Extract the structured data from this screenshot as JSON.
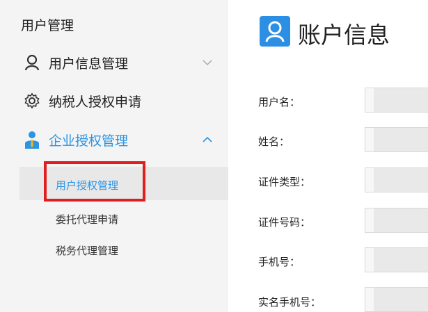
{
  "sidebar": {
    "title": "用户管理",
    "menu": [
      {
        "label": "用户信息管理",
        "icon": "user-outline-icon",
        "expanded": false
      },
      {
        "label": "纳税人授权申请",
        "icon": "gear-icon"
      },
      {
        "label": "企业授权管理",
        "icon": "business-user-icon",
        "expanded": true
      }
    ],
    "submenu": [
      {
        "label": "用户授权管理",
        "selected": true
      },
      {
        "label": "委托代理申请",
        "selected": false
      },
      {
        "label": "税务代理管理",
        "selected": false
      }
    ]
  },
  "main": {
    "header_title": "账户信息",
    "header_icon": "user-outline-icon",
    "fields": [
      {
        "label": "用户名："
      },
      {
        "label": "姓名："
      },
      {
        "label": "证件类型："
      },
      {
        "label": "证件号码："
      },
      {
        "label": "手机号："
      },
      {
        "label": "实名手机号："
      }
    ]
  },
  "colors": {
    "accent": "#2a94e5",
    "highlight_border": "#e01e1e",
    "sidebar_bg": "#f4f4f4"
  }
}
